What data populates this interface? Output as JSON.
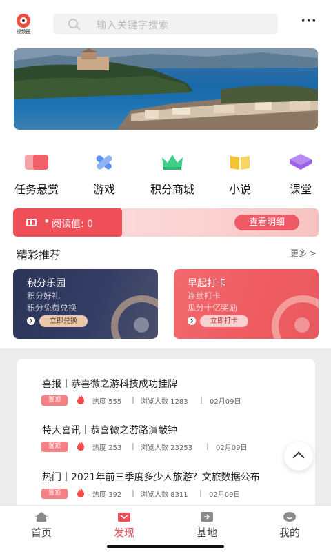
{
  "header": {
    "logo_text": "视频圈",
    "search_placeholder": "输入关键字搜索",
    "more_glyph": "···"
  },
  "quick_entries": [
    {
      "label": "任务悬赏",
      "icon": "task-icon",
      "color": "#f2606a"
    },
    {
      "label": "游戏",
      "icon": "game-icon",
      "color": "#5b8ff0"
    },
    {
      "label": "积分商城",
      "icon": "mall-icon",
      "color": "#3fce86"
    },
    {
      "label": "小说",
      "icon": "novel-icon",
      "color": "#f5c233"
    },
    {
      "label": "课堂",
      "icon": "class-icon",
      "color": "#9a63e8"
    }
  ],
  "reading": {
    "dot": "•",
    "label": "阅读值: 0",
    "detail_button": "查看明细"
  },
  "recommend": {
    "title": "精彩推荐",
    "more": "更多 >"
  },
  "cards": [
    {
      "title": "积分乐园",
      "sub1": "积分好礼",
      "sub2": "积分免费兑换",
      "button": "立即兑换"
    },
    {
      "title": "早起打卡",
      "sub1": "连续打卡",
      "sub2": "瓜分十亿奖励",
      "button": "立即打卡"
    }
  ],
  "news": [
    {
      "title": "喜报丨恭喜微之游科技成功挂牌",
      "tag": "置顶",
      "heat": "热度 555",
      "views": "浏览人数 1283",
      "date": "02月09日"
    },
    {
      "title": "特大喜讯丨恭喜微之游路演敲钟",
      "tag": "置顶",
      "heat": "热度 253",
      "views": "浏览人数 23253",
      "date": "02月09日"
    },
    {
      "title": "热门丨2021年前三季度多少人旅游？文旅数据公布",
      "tag": "置顶",
      "heat": "热度 392",
      "views": "浏览人数 8311",
      "date": "02月09日"
    }
  ],
  "tabs": [
    {
      "label": "首页",
      "icon": "home-icon"
    },
    {
      "label": "发现",
      "icon": "discover-icon",
      "active": true
    },
    {
      "label": "基地",
      "icon": "base-icon"
    },
    {
      "label": "我的",
      "icon": "profile-icon"
    }
  ],
  "colors": {
    "accent": "#ee4f57",
    "card_dark": "#2f3a62",
    "card_red": "#ef5c62"
  }
}
